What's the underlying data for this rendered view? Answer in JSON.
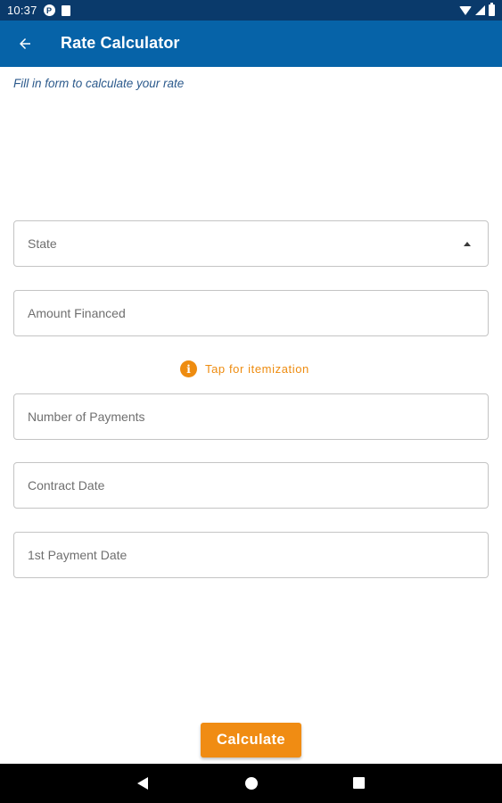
{
  "status_bar": {
    "time": "10:37",
    "icons": [
      "notification-p-icon",
      "sd-card-icon",
      "wifi-icon",
      "signal-icon",
      "battery-icon"
    ],
    "notification_letter": "P"
  },
  "app_bar": {
    "title": "Rate Calculator",
    "back_icon": "arrow-back-icon",
    "color": "#0663a8"
  },
  "form": {
    "instructions": "Fill in form to calculate your rate",
    "state_label": "State",
    "amount_financed_label": "Amount Financed",
    "itemization_label": "Tap for itemization",
    "itemization_icon_glyph": "i",
    "number_of_payments_label": "Number of Payments",
    "contract_date_label": "Contract Date",
    "first_payment_date_label": "1st Payment Date"
  },
  "actions": {
    "calculate_label": "Calculate",
    "accent_color": "#f08c13"
  },
  "nav_bar": {
    "icons": [
      "nav-back-icon",
      "nav-home-icon",
      "nav-recents-icon"
    ]
  }
}
